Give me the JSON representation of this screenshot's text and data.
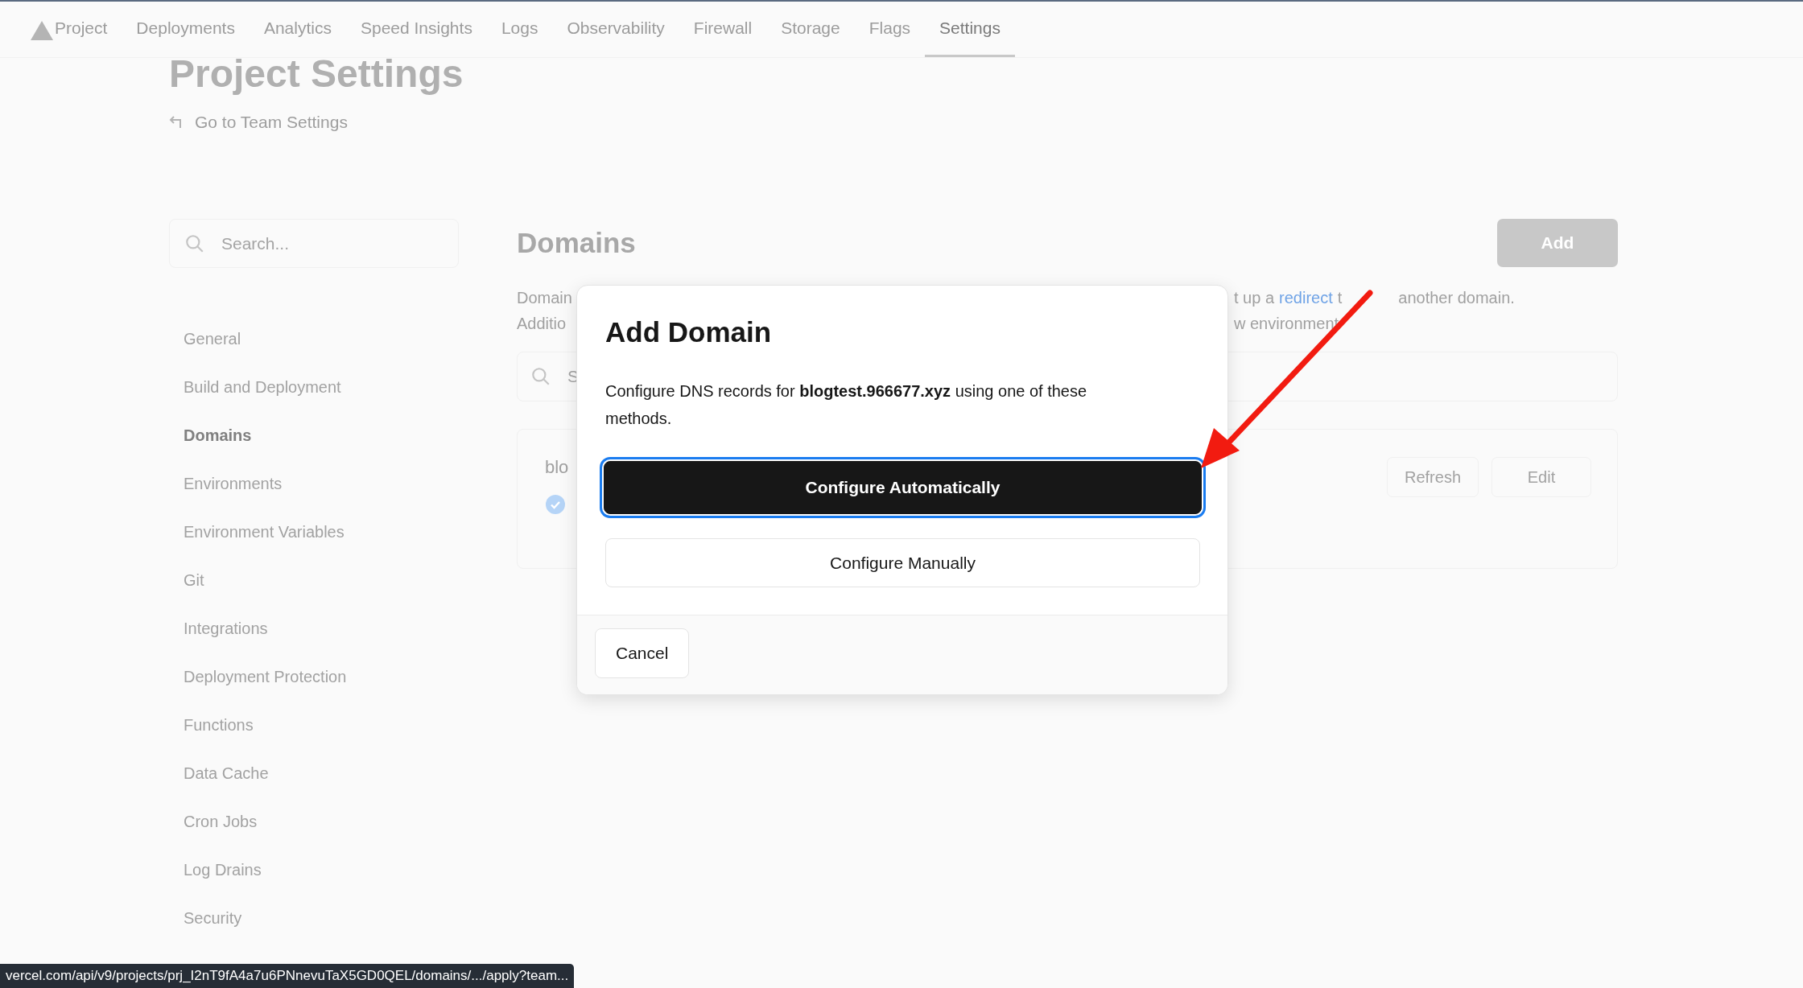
{
  "nav": {
    "tabs": [
      {
        "label": "Project",
        "selected": false
      },
      {
        "label": "Deployments",
        "selected": false
      },
      {
        "label": "Analytics",
        "selected": false
      },
      {
        "label": "Speed Insights",
        "selected": false
      },
      {
        "label": "Logs",
        "selected": false
      },
      {
        "label": "Observability",
        "selected": false
      },
      {
        "label": "Firewall",
        "selected": false
      },
      {
        "label": "Storage",
        "selected": false
      },
      {
        "label": "Flags",
        "selected": false
      },
      {
        "label": "Settings",
        "selected": true
      }
    ]
  },
  "header": {
    "title": "Project Settings",
    "back_link": "Go to Team Settings"
  },
  "sidebar": {
    "search": {
      "placeholder": "Search..."
    },
    "items": [
      {
        "label": "General",
        "selected": false
      },
      {
        "label": "Build and Deployment",
        "selected": false
      },
      {
        "label": "Domains",
        "selected": true
      },
      {
        "label": "Environments",
        "selected": false
      },
      {
        "label": "Environment Variables",
        "selected": false
      },
      {
        "label": "Git",
        "selected": false
      },
      {
        "label": "Integrations",
        "selected": false
      },
      {
        "label": "Deployment Protection",
        "selected": false
      },
      {
        "label": "Functions",
        "selected": false
      },
      {
        "label": "Data Cache",
        "selected": false
      },
      {
        "label": "Cron Jobs",
        "selected": false
      },
      {
        "label": "Log Drains",
        "selected": false
      },
      {
        "label": "Security",
        "selected": false
      }
    ]
  },
  "domains": {
    "title": "Domains",
    "add_button": "Add",
    "description_lines": [
      {
        "left": "Domain",
        "before": "t up a",
        "link": "redirect",
        "after": [
          "t",
          "another domain."
        ]
      },
      {
        "left": "Additio",
        "before": "w environment"
      }
    ],
    "search": {
      "placeholder": "S"
    },
    "card": {
      "domain": "blo",
      "verified": true,
      "buttons": [
        "Refresh",
        "Edit"
      ]
    }
  },
  "dialog": {
    "title": "Add Domain",
    "message": "Configure DNS records for **blogtest.966677.xyz** using one of these methods.",
    "options": [
      {
        "label": "Configure Automatically",
        "kind": "primary",
        "focused": true
      },
      {
        "label": "Configure Manually",
        "kind": "secondary",
        "focused": false
      }
    ],
    "cancel": "Cancel"
  },
  "status_bar": {
    "url": "vercel.com/api/v9/projects/prj_I2nT9fA4a7u6PNnevuTaX5GD0QEL/domains/.../apply?team..."
  }
}
